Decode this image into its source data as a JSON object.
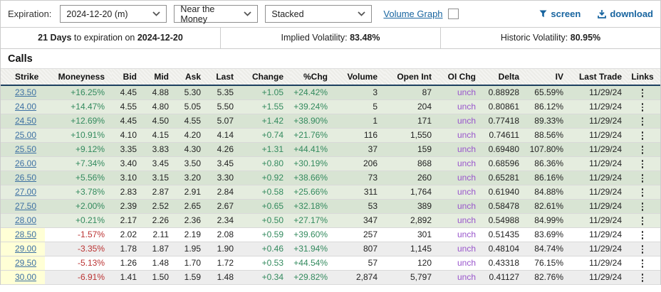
{
  "colors": {
    "accent_blue": "#17649f",
    "strike_link_blue": "#3e71a3",
    "positive_green": "#338a5e",
    "negative_red": "#bb3333",
    "unchanged_purple": "#9955cc",
    "itm_row_dark": "#d8e4d3",
    "itm_row_light": "#e5eddf",
    "otm_strike_yellow": "#ffffd6",
    "header_rule_navy": "#1d4060"
  },
  "toolbar": {
    "expiration_label": "Expiration:",
    "selects": [
      {
        "name": "expiration",
        "value": "2024-12-20 (m)"
      },
      {
        "name": "moneyness-filter",
        "value": "Near the Money"
      },
      {
        "name": "view-mode",
        "value": "Stacked"
      }
    ],
    "volume_graph_label": "Volume Graph",
    "screen_label": "screen",
    "download_label": "download"
  },
  "infobar": {
    "days_bold": "21 Days",
    "days_mid": " to expiration on ",
    "days_date": "2024-12-20",
    "iv_label": "Implied Volatility: ",
    "iv_value": "83.48%",
    "hv_label": "Historic Volatility: ",
    "hv_value": "80.95%"
  },
  "section_title": "Calls",
  "table": {
    "columns": [
      {
        "key": "strike",
        "label": "Strike"
      },
      {
        "key": "moneyness",
        "label": "Moneyness"
      },
      {
        "key": "bid",
        "label": "Bid"
      },
      {
        "key": "mid",
        "label": "Mid"
      },
      {
        "key": "ask",
        "label": "Ask"
      },
      {
        "key": "last",
        "label": "Last"
      },
      {
        "key": "change",
        "label": "Change"
      },
      {
        "key": "pct_chg",
        "label": "%Chg"
      },
      {
        "key": "volume",
        "label": "Volume"
      },
      {
        "key": "open_int",
        "label": "Open Int"
      },
      {
        "key": "oi_chg",
        "label": "OI Chg"
      },
      {
        "key": "delta",
        "label": "Delta"
      },
      {
        "key": "iv",
        "label": "IV"
      },
      {
        "key": "last_trade",
        "label": "Last Trade"
      },
      {
        "key": "links",
        "label": "Links"
      }
    ],
    "rows": [
      {
        "strike": "23.50",
        "moneyness": "+16.25%",
        "bid": "4.45",
        "mid": "4.88",
        "ask": "5.30",
        "last": "5.35",
        "change": "+1.05",
        "pct_chg": "+24.42%",
        "volume": "3",
        "open_int": "87",
        "oi_chg": "unch",
        "delta": "0.88928",
        "iv": "65.59%",
        "last_trade": "11/29/24",
        "itm": true
      },
      {
        "strike": "24.00",
        "moneyness": "+14.47%",
        "bid": "4.55",
        "mid": "4.80",
        "ask": "5.05",
        "last": "5.50",
        "change": "+1.55",
        "pct_chg": "+39.24%",
        "volume": "5",
        "open_int": "204",
        "oi_chg": "unch",
        "delta": "0.80861",
        "iv": "86.12%",
        "last_trade": "11/29/24",
        "itm": true
      },
      {
        "strike": "24.50",
        "moneyness": "+12.69%",
        "bid": "4.45",
        "mid": "4.50",
        "ask": "4.55",
        "last": "5.07",
        "change": "+1.42",
        "pct_chg": "+38.90%",
        "volume": "1",
        "open_int": "171",
        "oi_chg": "unch",
        "delta": "0.77418",
        "iv": "89.33%",
        "last_trade": "11/29/24",
        "itm": true
      },
      {
        "strike": "25.00",
        "moneyness": "+10.91%",
        "bid": "4.10",
        "mid": "4.15",
        "ask": "4.20",
        "last": "4.14",
        "change": "+0.74",
        "pct_chg": "+21.76%",
        "volume": "116",
        "open_int": "1,550",
        "oi_chg": "unch",
        "delta": "0.74611",
        "iv": "88.56%",
        "last_trade": "11/29/24",
        "itm": true
      },
      {
        "strike": "25.50",
        "moneyness": "+9.12%",
        "bid": "3.35",
        "mid": "3.83",
        "ask": "4.30",
        "last": "4.26",
        "change": "+1.31",
        "pct_chg": "+44.41%",
        "volume": "37",
        "open_int": "159",
        "oi_chg": "unch",
        "delta": "0.69480",
        "iv": "107.80%",
        "last_trade": "11/29/24",
        "itm": true
      },
      {
        "strike": "26.00",
        "moneyness": "+7.34%",
        "bid": "3.40",
        "mid": "3.45",
        "ask": "3.50",
        "last": "3.45",
        "change": "+0.80",
        "pct_chg": "+30.19%",
        "volume": "206",
        "open_int": "868",
        "oi_chg": "unch",
        "delta": "0.68596",
        "iv": "86.36%",
        "last_trade": "11/29/24",
        "itm": true
      },
      {
        "strike": "26.50",
        "moneyness": "+5.56%",
        "bid": "3.10",
        "mid": "3.15",
        "ask": "3.20",
        "last": "3.30",
        "change": "+0.92",
        "pct_chg": "+38.66%",
        "volume": "73",
        "open_int": "260",
        "oi_chg": "unch",
        "delta": "0.65281",
        "iv": "86.16%",
        "last_trade": "11/29/24",
        "itm": true
      },
      {
        "strike": "27.00",
        "moneyness": "+3.78%",
        "bid": "2.83",
        "mid": "2.87",
        "ask": "2.91",
        "last": "2.84",
        "change": "+0.58",
        "pct_chg": "+25.66%",
        "volume": "311",
        "open_int": "1,764",
        "oi_chg": "unch",
        "delta": "0.61940",
        "iv": "84.88%",
        "last_trade": "11/29/24",
        "itm": true
      },
      {
        "strike": "27.50",
        "moneyness": "+2.00%",
        "bid": "2.39",
        "mid": "2.52",
        "ask": "2.65",
        "last": "2.67",
        "change": "+0.65",
        "pct_chg": "+32.18%",
        "volume": "53",
        "open_int": "389",
        "oi_chg": "unch",
        "delta": "0.58478",
        "iv": "82.61%",
        "last_trade": "11/29/24",
        "itm": true
      },
      {
        "strike": "28.00",
        "moneyness": "+0.21%",
        "bid": "2.17",
        "mid": "2.26",
        "ask": "2.36",
        "last": "2.34",
        "change": "+0.50",
        "pct_chg": "+27.17%",
        "volume": "347",
        "open_int": "2,892",
        "oi_chg": "unch",
        "delta": "0.54988",
        "iv": "84.99%",
        "last_trade": "11/29/24",
        "itm": true
      },
      {
        "strike": "28.50",
        "moneyness": "-1.57%",
        "bid": "2.02",
        "mid": "2.11",
        "ask": "2.19",
        "last": "2.08",
        "change": "+0.59",
        "pct_chg": "+39.60%",
        "volume": "257",
        "open_int": "301",
        "oi_chg": "unch",
        "delta": "0.51435",
        "iv": "83.69%",
        "last_trade": "11/29/24",
        "itm": false
      },
      {
        "strike": "29.00",
        "moneyness": "-3.35%",
        "bid": "1.78",
        "mid": "1.87",
        "ask": "1.95",
        "last": "1.90",
        "change": "+0.46",
        "pct_chg": "+31.94%",
        "volume": "807",
        "open_int": "1,145",
        "oi_chg": "unch",
        "delta": "0.48104",
        "iv": "84.74%",
        "last_trade": "11/29/24",
        "itm": false
      },
      {
        "strike": "29.50",
        "moneyness": "-5.13%",
        "bid": "1.26",
        "mid": "1.48",
        "ask": "1.70",
        "last": "1.72",
        "change": "+0.53",
        "pct_chg": "+44.54%",
        "volume": "57",
        "open_int": "120",
        "oi_chg": "unch",
        "delta": "0.43318",
        "iv": "76.15%",
        "last_trade": "11/29/24",
        "itm": false
      },
      {
        "strike": "30.00",
        "moneyness": "-6.91%",
        "bid": "1.41",
        "mid": "1.50",
        "ask": "1.59",
        "last": "1.48",
        "change": "+0.34",
        "pct_chg": "+29.82%",
        "volume": "2,874",
        "open_int": "5,797",
        "oi_chg": "unch",
        "delta": "0.41127",
        "iv": "82.76%",
        "last_trade": "11/29/24",
        "itm": false
      }
    ]
  }
}
